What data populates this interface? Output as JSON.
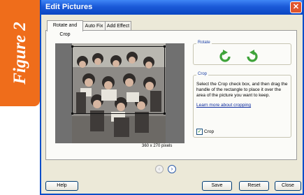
{
  "badge": {
    "text": "Figure 2",
    "color": "#ef6d1b"
  },
  "window": {
    "title": "Edit Pictures",
    "close_icon": "close-x-icon",
    "title_color": "#1b5ad8"
  },
  "tabs": [
    {
      "label": "Rotate and Crop",
      "active": true
    },
    {
      "label": "Auto Fix",
      "active": false
    },
    {
      "label": "Add Effect",
      "active": false
    }
  ],
  "preview": {
    "dimensions": "360 x 270 pixels"
  },
  "rotate": {
    "label": "Rotate",
    "buttons": [
      {
        "icon": "rotate-left-icon"
      },
      {
        "icon": "rotate-right-icon"
      }
    ]
  },
  "crop": {
    "label": "Crop",
    "instructions": "Select the Crop check box, and then drag the handle of the rectangle to place it over the area of the picture you want to keep.",
    "link": "Learn more about cropping",
    "checkbox_label": "Crop",
    "checked": true
  },
  "navigation": {
    "prev_icon": "previous-arrow-icon",
    "next_icon": "next-arrow-icon"
  },
  "buttons": {
    "help": "Help",
    "save": "Save",
    "reset": "Reset",
    "close": "Close"
  }
}
